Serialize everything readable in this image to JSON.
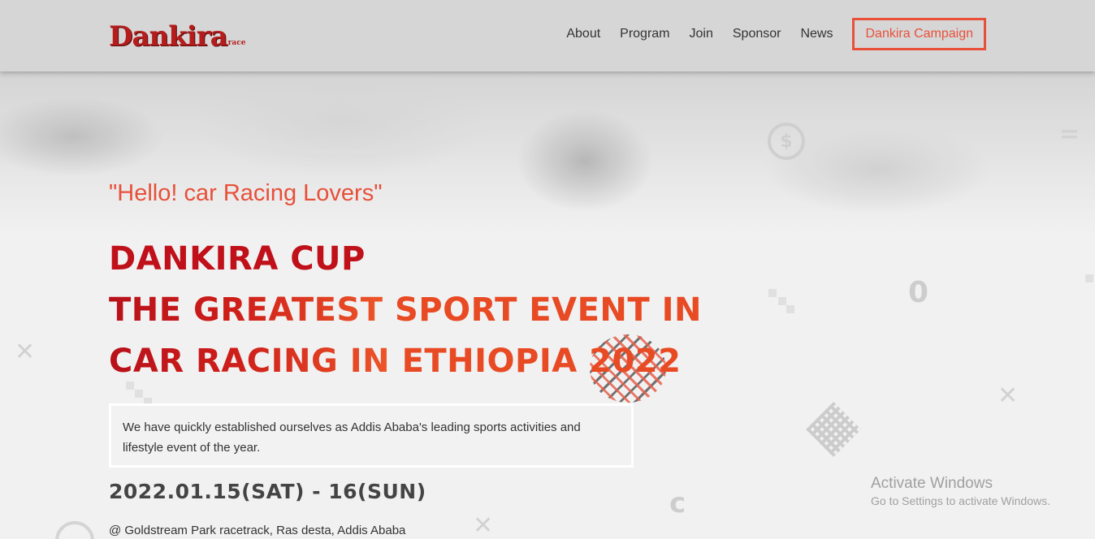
{
  "header": {
    "logo_text": "Dankira",
    "logo_sub": "race",
    "nav": [
      {
        "label": "About"
      },
      {
        "label": "Program"
      },
      {
        "label": "Join"
      },
      {
        "label": "Sponsor"
      },
      {
        "label": "News"
      }
    ],
    "cta_label": "Dankira Campaign"
  },
  "hero": {
    "tagline": "\"Hello! car Racing Lovers\"",
    "headline": {
      "line1": "DANKIRA CUP",
      "line2_a": "THE GREATEST ",
      "line2_b": "SPORT EVENT IN",
      "line3_a": "CAR RACING IN ",
      "line3_b": "ETHIOPIA 2022"
    },
    "description": "We have quickly established ourselves as Addis Ababa's leading sports activities and lifestyle event of the year.",
    "date": "2022.01.15(SAT) - 16(SUN)",
    "venue": "@ Goldstream Park racetrack, Ras desta, Addis Ababa"
  },
  "deco": {
    "coin_symbol": "$",
    "zero_glyph": "0",
    "c_glyph": "c",
    "x_glyph": "✕",
    "eq_glyph": "="
  },
  "watermark": {
    "title": "Activate Windows",
    "subtitle": "Go to Settings to activate Windows."
  },
  "colors": {
    "accent": "#e8503a",
    "headline_red": "#c0101a",
    "headline_orange": "#e84a24",
    "header_bg": "#d6d6d6"
  }
}
